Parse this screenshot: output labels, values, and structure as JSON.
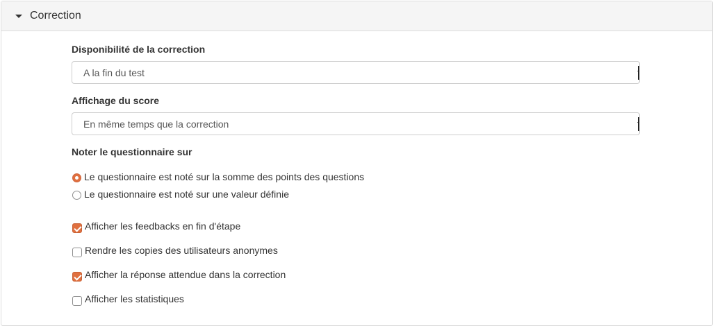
{
  "panel": {
    "title": "Correction",
    "caret_icon": "caret-down-icon"
  },
  "availability": {
    "label": "Disponibilité de la correction",
    "selected": "A la fin du test"
  },
  "score_display": {
    "label": "Affichage du score",
    "selected": "En même temps que la correction"
  },
  "grading": {
    "label": "Noter le questionnaire sur",
    "options": [
      {
        "label": "Le questionnaire est noté sur la somme des points des questions",
        "checked": true
      },
      {
        "label": "Le questionnaire est noté sur une valeur définie",
        "checked": false
      }
    ]
  },
  "checkboxes": [
    {
      "label": "Afficher les feedbacks en fin d'étape",
      "checked": true
    },
    {
      "label": "Rendre les copies des utilisateurs anonymes",
      "checked": false
    },
    {
      "label": "Afficher la réponse attendue dans la correction",
      "checked": true
    },
    {
      "label": "Afficher les statistiques",
      "checked": false
    }
  ],
  "colors": {
    "accent": "#e0703f",
    "heading_bg": "#f5f5f5",
    "border": "#dddddd"
  }
}
